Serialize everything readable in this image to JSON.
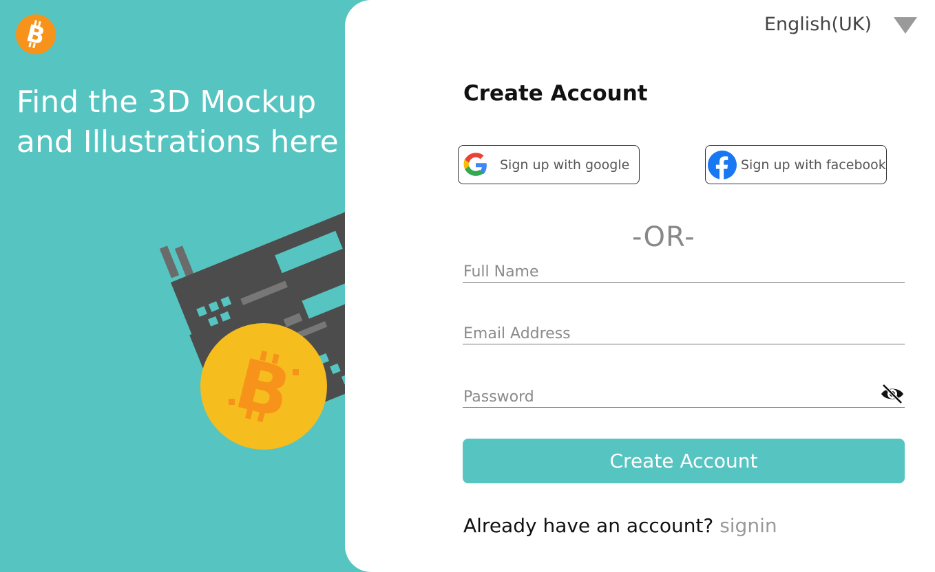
{
  "hero": {
    "title": "Find the 3D Mockup and Illustrations here"
  },
  "language": {
    "selected": "English(UK)"
  },
  "form": {
    "title": "Create Account",
    "google_label": "Sign up with google",
    "facebook_label": "Sign up with facebook",
    "or_text": "-OR-",
    "full_name_placeholder": "Full Name",
    "email_placeholder": "Email Address",
    "password_placeholder": "Password",
    "submit_label": "Create Account",
    "signin_prompt": "Already have an account?",
    "signin_link": "signin"
  },
  "colors": {
    "accent": "#56c4c0",
    "bitcoin_orange": "#f7931a",
    "coin_yellow": "#f6bd1f",
    "device_gray": "#4c4c4c"
  }
}
